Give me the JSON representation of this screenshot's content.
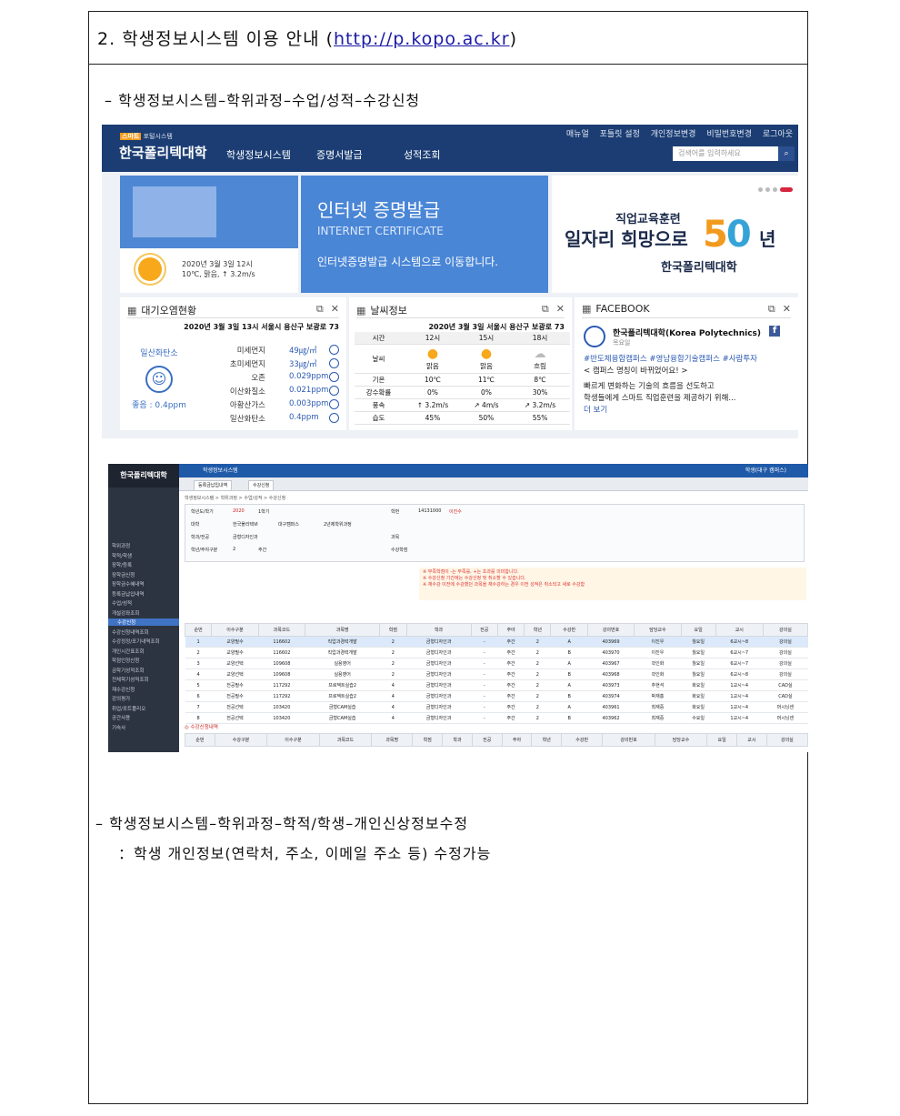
{
  "doc": {
    "section_num": "2.",
    "section_title": "학생정보시스템 이용 안내",
    "url": "http://p.kopo.ac.kr",
    "bullet1": "–  학생정보시스템–학위과정–수업/성적–수강신청",
    "bullet2": "–  학생정보시스템–학위과정–학적/학생–개인신상정보수정",
    "bullet2_note": "：학생 개인정보(연락처, 주소, 이메일 주소 등) 수정가능"
  },
  "portal": {
    "logo_small": "포털시스템",
    "logo_badge": "스마트",
    "logo": "한국폴리텍대학",
    "nav": [
      "학생정보시스템",
      "증명서발급",
      "성적조회"
    ],
    "util": [
      "매뉴얼",
      "포틀릿 설정",
      "개인정보변경",
      "비밀번호변경",
      "로그아웃"
    ],
    "search_placeholder": "검색어를 입력하세요",
    "weather_date": "2020년 3월 3일 12시",
    "weather_detail": "10℃, 맑음, ↑ 3.2m/s",
    "cert_title": "인터넷 증명발급",
    "cert_sub": "INTERNET CERTIFICATE",
    "cert_link": "인터넷증명발급 시스템으로 이동합니다.",
    "poly_line1": "직업교육훈련",
    "poly_line2": "일자리 희망으로",
    "poly_50a": "5",
    "poly_50b": "0",
    "poly_nyeon": "년",
    "poly_line3": "한국폴리텍대학",
    "air": {
      "title": "대기오염현황",
      "caption": "2020년 3월 3일 13시 서울시 용산구 보광로 73",
      "left_label": "일산화탄소",
      "left_value": "좋음 : 0.4ppm",
      "rows": [
        {
          "name": "미세먼지",
          "value": "49㎍/㎥"
        },
        {
          "name": "초미세먼지",
          "value": "33㎍/㎥"
        },
        {
          "name": "오존",
          "value": "0.029ppm"
        },
        {
          "name": "이산화질소",
          "value": "0.021ppm"
        },
        {
          "name": "아황산가스",
          "value": "0.003ppm"
        },
        {
          "name": "일산화탄소",
          "value": "0.4ppm"
        }
      ]
    },
    "weather": {
      "title": "날씨정보",
      "caption": "2020년 3월 3일 서울시 용산구 보광로 73",
      "headers": [
        "시간",
        "12시",
        "15시",
        "18시"
      ],
      "rows": [
        [
          "날씨",
          "맑음",
          "맑음",
          "흐림"
        ],
        [
          "기온",
          "10℃",
          "11℃",
          "8℃"
        ],
        [
          "강수확률",
          "0%",
          "0%",
          "30%"
        ],
        [
          "풍속",
          "↑ 3.2m/s",
          "↗ 4m/s",
          "↗ 3.2m/s"
        ],
        [
          "습도",
          "45%",
          "50%",
          "55%"
        ]
      ]
    },
    "facebook": {
      "title": "FACEBOOK",
      "name": "한국폴리텍대학(Korea Polytechnics)",
      "sub": "목요일",
      "tags": "#반도체융합캠퍼스 #영남융합기술캠퍼스 #사람투자",
      "line1": "< 캠퍼스 명칭이 바뀌었어요! >",
      "line2": "빠르게 변화하는 기술의 흐름을 선도하고",
      "line3": "학생들에게 스마트 직업훈련을 제공하기 위해...",
      "more": "더 보기"
    }
  },
  "sis": {
    "logo": "한국폴리텍대학",
    "topbar": "학생정보시스템",
    "user": "학생(대구 캠퍼스)",
    "tabs": [
      "등록금납입내역",
      "수강신청"
    ],
    "breadcrumb": "학생정보시스템 > 학위과정 > 수업/성적 > 수강신청",
    "menu": [
      {
        "label": "학위과정",
        "hl": false
      },
      {
        "label": "학적/학생",
        "hl": false
      },
      {
        "label": "장학/등록",
        "hl": false
      },
      {
        "label": "장학금신청",
        "hl": false
      },
      {
        "label": "장학금수혜내역",
        "hl": false
      },
      {
        "label": "등록금납입내역",
        "hl": false
      },
      {
        "label": "수업/성적",
        "hl": false
      },
      {
        "label": "개설강좌조회",
        "hl": false
      },
      {
        "label": "수강신청",
        "hl": true
      },
      {
        "label": "수강신청내역조회",
        "hl": false
      },
      {
        "label": "수강정정/포기내역조회",
        "hl": false
      },
      {
        "label": "개인시간표조회",
        "hl": false
      },
      {
        "label": "학점인정신청",
        "hl": false
      },
      {
        "label": "금학기성적조회",
        "hl": false
      },
      {
        "label": "전체학기성적조회",
        "hl": false
      },
      {
        "label": "재수강신청",
        "hl": false
      },
      {
        "label": "강의평가",
        "hl": false
      },
      {
        "label": "취업/포트폴리오",
        "hl": false
      },
      {
        "label": "공간사용",
        "hl": false
      },
      {
        "label": "기숙사",
        "hl": false
      }
    ],
    "form": {
      "year_label": "학년도/학기",
      "year": "2020",
      "term": "1학기",
      "college_label": "대학",
      "college": "한국폴리텍Ⅵ",
      "campus": "대구캠퍼스",
      "course": "2년제학위과정",
      "dept_label": "학과/전공",
      "dept": "금형디자인과",
      "grade_label": "학년/주야구분",
      "grade": "2",
      "daynight": "주간",
      "id_label": "학번",
      "id": "14131000",
      "name": "이진수",
      "subj_label": "과목",
      "credit_label": "수강학점"
    },
    "notice": [
      "※ 부족학점이 -는 부족를, +는 초과를 의미합니다.",
      "※ 수강신청 기간에는 수강신청 및 취소할 수 있습니다.",
      "※ 재수강 이전에 수강했던 과목을 재수강하는 경우 이전 성적은 취소되고 새로 수강함"
    ],
    "grid_headers": [
      "순번",
      "이수구분",
      "과목코드",
      "과목명",
      "학점",
      "학과",
      "전공",
      "주야",
      "학년",
      "수강반",
      "강의번호",
      "담당교수",
      "요일",
      "교시",
      "강의실"
    ],
    "grid_rows": [
      [
        "1",
        "교양필수",
        "116602",
        "직업과경력개발",
        "2",
        "금형디자인과",
        "-",
        "주간",
        "2",
        "A",
        "403969",
        "이진우",
        "월요일",
        "6교시~8",
        "강의실"
      ],
      [
        "2",
        "교양필수",
        "116602",
        "직업과경력개발",
        "2",
        "금형디자인과",
        "-",
        "주간",
        "2",
        "B",
        "403970",
        "이진우",
        "월요일",
        "6교시~7",
        "강의실"
      ],
      [
        "3",
        "교양선택",
        "109608",
        "실용영어",
        "2",
        "금형디자인과",
        "-",
        "주간",
        "2",
        "A",
        "403967",
        "곽인화",
        "월요일",
        "6교시~7",
        "강의실"
      ],
      [
        "4",
        "교양선택",
        "109608",
        "실용영어",
        "2",
        "금형디자인과",
        "-",
        "주간",
        "2",
        "B",
        "403968",
        "곽인화",
        "월요일",
        "6교시~8",
        "강의실"
      ],
      [
        "5",
        "전공필수",
        "117292",
        "프로젝트실습2",
        "4",
        "금형디자인과",
        "-",
        "주간",
        "2",
        "A",
        "403973",
        "추현석",
        "화요일",
        "1교시~4",
        "CAD실"
      ],
      [
        "6",
        "전공필수",
        "117292",
        "프로젝트실습2",
        "4",
        "금형디자인과",
        "-",
        "주간",
        "2",
        "B",
        "403974",
        "박재홍",
        "화요일",
        "1교시~4",
        "CAD실"
      ],
      [
        "7",
        "전공선택",
        "103420",
        "금형CAM실습",
        "4",
        "금형디자인과",
        "-",
        "주간",
        "2",
        "A",
        "403961",
        "최재중",
        "화요일",
        "1교시~4",
        "머시닝센"
      ],
      [
        "8",
        "전공선택",
        "103420",
        "금형CAM실습",
        "4",
        "금형디자인과",
        "-",
        "주간",
        "2",
        "B",
        "403962",
        "최재중",
        "수요일",
        "1교시~4",
        "머시닝센"
      ]
    ],
    "section2": "◎ 수강신청내역",
    "grid2_headers": [
      "순번",
      "수강구분",
      "이수구분",
      "과목코드",
      "과목명",
      "학점",
      "학과",
      "전공",
      "주야",
      "학년",
      "수강반",
      "강의번호",
      "담당교수",
      "요일",
      "교시",
      "강의실"
    ]
  },
  "colors": {
    "portal_header": "#1b3d73",
    "cert_blue": "#4a86d6",
    "accent_orange": "#f29a1d",
    "sis_side": "#2d3441",
    "sis_top": "#1f5aa8"
  }
}
